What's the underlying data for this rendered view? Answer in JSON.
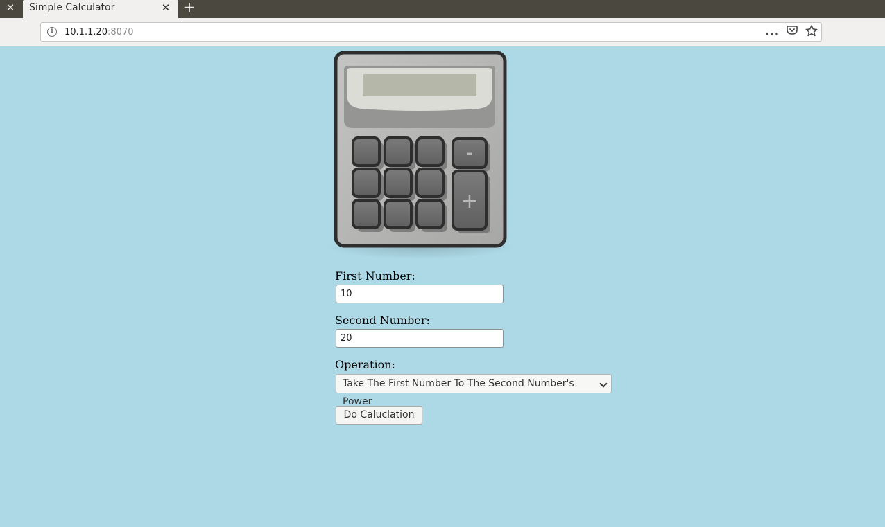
{
  "browser": {
    "tab_title": "Simple Calculator",
    "tab_close_glyph": "✕",
    "new_tab_glyph": "+",
    "url_host": "10.1.1.20",
    "url_port": ":8070",
    "icons": [
      "close-icon",
      "info-icon",
      "more-icon",
      "pocket-icon",
      "bookmark-star-icon"
    ]
  },
  "page": {
    "image": {
      "icon": "calculator-icon",
      "minus_label": "-",
      "plus_label": "+"
    },
    "form": {
      "first_label": "First Number:",
      "first_value": "10",
      "second_label": "Second Number:",
      "second_value": "20",
      "operation_label": "Operation:",
      "operation_selected": "Take The First Number To The Second Number's Power",
      "submit_label": "Do Caluclation"
    }
  },
  "colors": {
    "page_background": "#add8e6",
    "tabbar": "#4b4840",
    "toolbar": "#f1f0ee"
  }
}
